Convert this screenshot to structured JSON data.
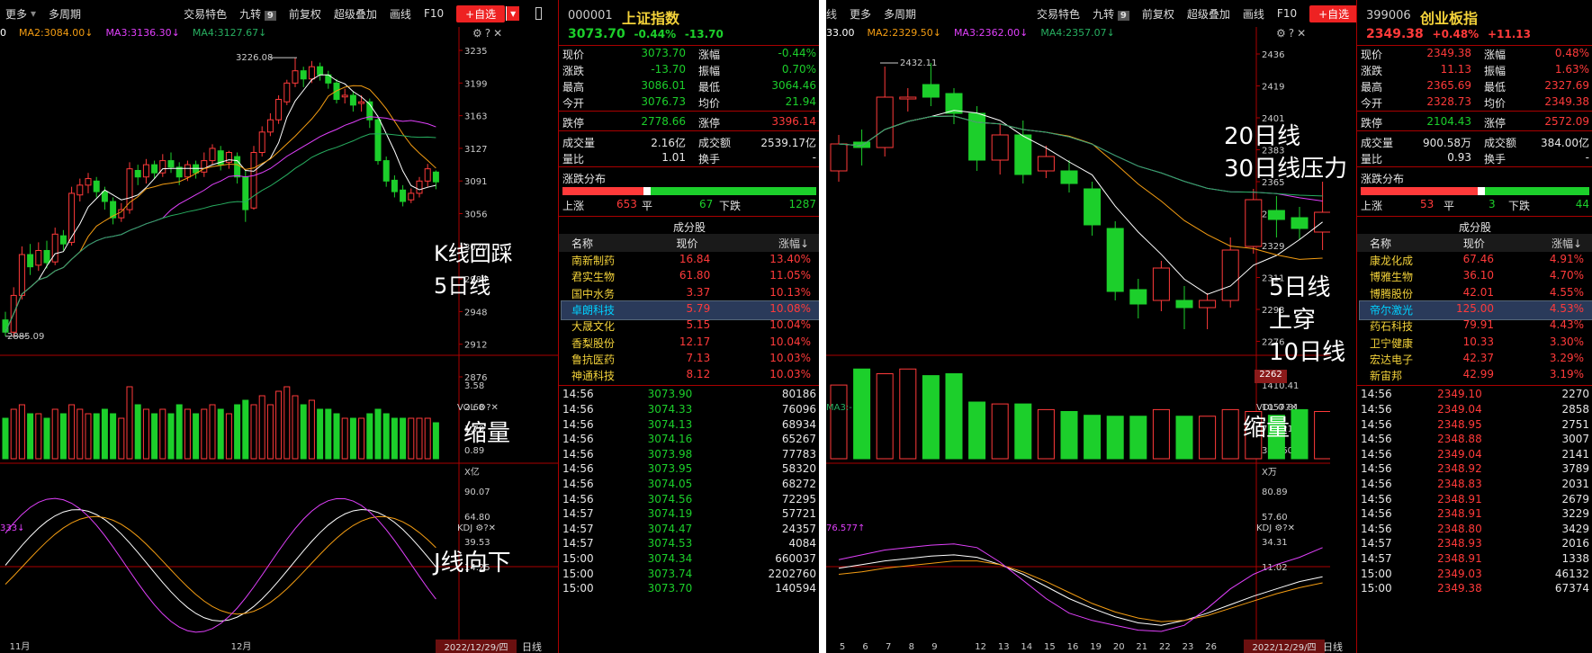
{
  "common": {
    "menu_more": "更多",
    "menu_period": "多周期",
    "menu_trade": "交易特色",
    "menu_nine": "九转",
    "nine_badge": "9",
    "menu_adjust": "前复权",
    "menu_overlay": "超级叠加",
    "menu_draw": "画线",
    "menu_f10": "F10",
    "add_btn": "+自选",
    "vol_label": "VOL",
    "kdj_label": "KDJ",
    "date_label": "2022/12/29/四",
    "period": "日线",
    "cons_title": "成分股",
    "col_name": "名称",
    "col_price": "现价",
    "col_chg": "涨幅↓",
    "dist_title": "涨跌分布",
    "up_lbl": "上涨",
    "flat_lbl": "平",
    "down_lbl": "下跌",
    "colors": {
      "up": "#ff3a3a",
      "down": "#1ccf2b",
      "ma1": "#ffffff",
      "ma2": "#f39c12",
      "ma3": "#e040fb",
      "ma4": "#27ae60",
      "grid": "#aa0000"
    }
  },
  "left": {
    "ma_row": [
      "0",
      "MA2:3084.00↓",
      "MA3:3136.30↓",
      "MA4:3127.67↓"
    ],
    "y_ticks": [
      "3235",
      "3199",
      "3163",
      "3127",
      "3091",
      "3056",
      "3020",
      "2984",
      "2948",
      "2912",
      "2876"
    ],
    "high_label": "3226.08",
    "low_label": "2885.09",
    "vol_ticks": [
      "3.58",
      "2.68",
      "1.79",
      "0.89",
      "X亿"
    ],
    "kdj_top": "333↓",
    "kdj_ticks": [
      "90.07",
      "64.80",
      "39.53",
      "14.25"
    ],
    "x_labels": [
      "11月",
      "12月"
    ],
    "note_k": "K线回踩\n5日线",
    "note_vol": "缩量",
    "note_j": "J线向下",
    "info": {
      "code": "000001",
      "name": "上证指数",
      "price": "3073.70",
      "chg_pct": "-0.44%",
      "chg": "-13.70",
      "stats": [
        [
          "现价",
          "3073.70",
          "涨幅",
          "-0.44%"
        ],
        [
          "涨跌",
          "-13.70",
          "振幅",
          "0.70%"
        ],
        [
          "最高",
          "3086.01",
          "最低",
          "3064.46"
        ],
        [
          "今开",
          "3076.73",
          "均价",
          "21.94"
        ],
        [
          "跌停",
          "2778.66",
          "涨停",
          "3396.14"
        ],
        [
          "成交量",
          "2.16亿",
          "成交额",
          "2539.17亿"
        ],
        [
          "量比",
          "1.01",
          "换手",
          "-"
        ]
      ],
      "up": "653",
      "flat": "67",
      "down": "1287",
      "cons": [
        [
          "南新制药",
          "16.84",
          "13.40%"
        ],
        [
          "君实生物",
          "61.80",
          "11.05%"
        ],
        [
          "国中水务",
          "3.37",
          "10.13%"
        ],
        [
          "卓朗科技",
          "5.79",
          "10.08%"
        ],
        [
          "大晟文化",
          "5.15",
          "10.04%"
        ],
        [
          "香梨股份",
          "12.17",
          "10.04%"
        ],
        [
          "鲁抗医药",
          "7.13",
          "10.03%"
        ],
        [
          "神通科技",
          "8.12",
          "10.03%"
        ]
      ],
      "ticks": [
        [
          "14:56",
          "3073.90",
          "80186"
        ],
        [
          "14:56",
          "3074.33",
          "76096"
        ],
        [
          "14:56",
          "3074.13",
          "68934"
        ],
        [
          "14:56",
          "3074.16",
          "65267"
        ],
        [
          "14:56",
          "3073.98",
          "77783"
        ],
        [
          "14:56",
          "3073.95",
          "58320"
        ],
        [
          "14:56",
          "3074.05",
          "68272"
        ],
        [
          "14:56",
          "3074.56",
          "72295"
        ],
        [
          "14:57",
          "3074.19",
          "57721"
        ],
        [
          "14:57",
          "3074.47",
          "24357"
        ],
        [
          "14:57",
          "3074.53",
          "4084"
        ],
        [
          "15:00",
          "3074.34",
          "660037"
        ],
        [
          "15:00",
          "3073.74",
          "2202760"
        ],
        [
          "15:00",
          "3073.70",
          "140594"
        ]
      ]
    }
  },
  "right": {
    "ma_row": [
      "33.00",
      "MA2:2329.50↓",
      "MA3:2362.00↓",
      "MA4:2357.07↓"
    ],
    "y_ticks": [
      "2436",
      "2419",
      "2401",
      "2383",
      "2365",
      "2347",
      "2329",
      "2311",
      "2293",
      "2276"
    ],
    "high_label": "2432.11",
    "price_tag": "2262",
    "vol_top": "MA3:-",
    "vol_ticks": [
      "1410.41",
      "1057.81",
      "705.21",
      "352.60",
      "X万"
    ],
    "kdj_top": "76.577↑",
    "kdj_ticks": [
      "80.89",
      "57.60",
      "34.31",
      "11.02"
    ],
    "x_labels": [
      "5",
      "6",
      "7",
      "8",
      "9",
      "12",
      "13",
      "14",
      "15",
      "16",
      "19",
      "20",
      "21",
      "22",
      "23",
      "26"
    ],
    "note_ma": "20日线\n30日线压力",
    "note_cross": "5日线\n上穿\n10日线",
    "note_vol": "缩量",
    "info": {
      "code": "399006",
      "name": "创业板指",
      "price": "2349.38",
      "chg_pct": "+0.48%",
      "chg": "+11.13",
      "stats": [
        [
          "现价",
          "2349.38",
          "涨幅",
          "0.48%"
        ],
        [
          "涨跌",
          "11.13",
          "振幅",
          "1.63%"
        ],
        [
          "最高",
          "2365.69",
          "最低",
          "2327.69"
        ],
        [
          "今开",
          "2328.73",
          "均价",
          "2349.38"
        ],
        [
          "跌停",
          "2104.43",
          "涨停",
          "2572.09"
        ],
        [
          "成交量",
          "900.58万",
          "成交额",
          "384.00亿"
        ],
        [
          "量比",
          "0.93",
          "换手",
          "-"
        ]
      ],
      "up": "53",
      "flat": "3",
      "down": "44",
      "cons": [
        [
          "康龙化成",
          "67.46",
          "4.91%"
        ],
        [
          "博雅生物",
          "36.10",
          "4.70%"
        ],
        [
          "博腾股份",
          "42.01",
          "4.55%"
        ],
        [
          "帝尔激光",
          "125.00",
          "4.53%"
        ],
        [
          "药石科技",
          "79.91",
          "4.43%"
        ],
        [
          "卫宁健康",
          "10.33",
          "3.30%"
        ],
        [
          "宏达电子",
          "42.37",
          "3.29%"
        ],
        [
          "新宙邦",
          "42.99",
          "3.19%"
        ]
      ],
      "ticks": [
        [
          "14:56",
          "2349.10",
          "2270"
        ],
        [
          "14:56",
          "2349.04",
          "2858"
        ],
        [
          "14:56",
          "2348.95",
          "2751"
        ],
        [
          "14:56",
          "2348.88",
          "3007"
        ],
        [
          "14:56",
          "2349.04",
          "2141"
        ],
        [
          "14:56",
          "2348.92",
          "3789"
        ],
        [
          "14:56",
          "2348.83",
          "2031"
        ],
        [
          "14:56",
          "2348.91",
          "2679"
        ],
        [
          "14:56",
          "2348.91",
          "3229"
        ],
        [
          "14:56",
          "2348.80",
          "3429"
        ],
        [
          "14:57",
          "2348.93",
          "2016"
        ],
        [
          "14:57",
          "2348.91",
          "1338"
        ],
        [
          "15:00",
          "2349.03",
          "46132"
        ],
        [
          "15:00",
          "2349.38",
          "67374"
        ]
      ]
    }
  }
}
